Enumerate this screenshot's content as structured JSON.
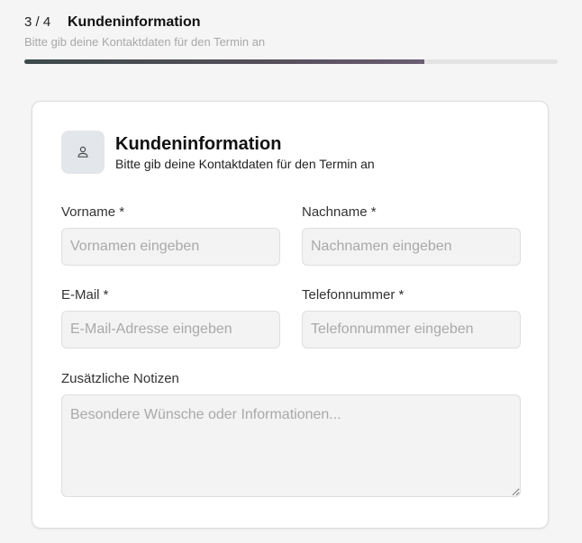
{
  "progress": {
    "step_label": "3 / 4",
    "title": "Kundeninformation",
    "subtitle": "Bitte gib deine Kontaktdaten für den Termin an",
    "fraction": 0.75
  },
  "card": {
    "icon": "user-icon",
    "title": "Kundeninformation",
    "subtitle": "Bitte gib deine Kontaktdaten für den Termin an"
  },
  "form": {
    "first_name": {
      "label": "Vorname *",
      "placeholder": "Vornamen eingeben",
      "value": ""
    },
    "last_name": {
      "label": "Nachname *",
      "placeholder": "Nachnamen eingeben",
      "value": ""
    },
    "email": {
      "label": "E-Mail *",
      "placeholder": "E-Mail-Adresse eingeben",
      "value": ""
    },
    "phone": {
      "label": "Telefonnummer *",
      "placeholder": "Telefonnummer eingeben",
      "value": ""
    },
    "notes": {
      "label": "Zusätzliche Notizen",
      "placeholder": "Besondere Wünsche oder Informationen...",
      "value": ""
    }
  }
}
